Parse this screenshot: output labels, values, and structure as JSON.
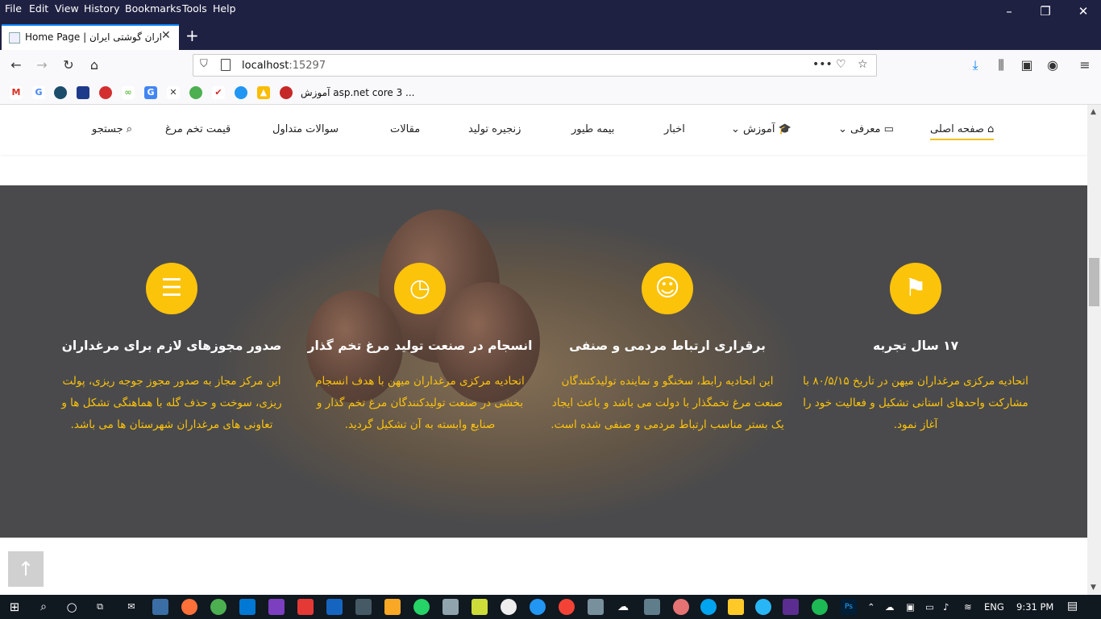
{
  "menubar": {
    "items": [
      "File",
      "Edit",
      "View",
      "History",
      "Bookmarks",
      "Tools",
      "Help"
    ]
  },
  "tab": {
    "title": "Home Page | مرغداران گوشتی ایران",
    "close": "✕",
    "new": "+"
  },
  "url": {
    "host": "localhost",
    "port": ":15297"
  },
  "bookmarks": {
    "text": "آموزش asp.net core 3 ..."
  },
  "sitenav": {
    "home": "صفحه اصلی",
    "intro": "معرفی",
    "education": "آموزش",
    "news": "اخبار",
    "poultry_insurance": "بیمه طیور",
    "supply_chain": "زنجیره تولید",
    "articles": "مقالات",
    "faq": "سوالات متداول",
    "egg_price": "قیمت تخم مرغ",
    "search": "جستجو"
  },
  "features": [
    {
      "title": "۱۷ سال تجربه",
      "desc": "اتحادیه مرکزی مرغداران میهن در تاریخ ۸۰/۵/۱۵ با مشارکت واحدهای استانی تشکیل و فعالیت خود را آغاز نمود.",
      "icon": "flag-icon"
    },
    {
      "title": "برقراری ارتباط مردمی و صنفی",
      "desc": "این اتحادیه رابط، سخنگو و نماینده تولیدکنندگان صنعت مرغ تخمگذار با دولت می باشد و باعث ایجاد یک بستر مناسب ارتباط مردمی و صنفی شده است.",
      "icon": "user-contact-icon"
    },
    {
      "title": "انسجام در صنعت تولید مرغ تخم گذار",
      "desc": "اتحادیه مرکزی مرغداران میهن با هدف انسجام بخشی در صنعت تولیدکنندگان مرغ تخم گذار و صنایع وابسته به آن تشکیل گردید.",
      "icon": "clock-icon"
    },
    {
      "title": "صدور مجوزهای لازم برای مرغداران",
      "desc": "این مرکز مجاز به صدور مجوز جوجه ریزی، پولت ریزی، سوخت و حذف گله با هماهنگی تشکل ها و تعاونی های مرغداران شهرستان ها می باشد.",
      "icon": "sliders-icon"
    }
  ],
  "taskbar": {
    "lang": "ENG",
    "time": "9:31 PM"
  },
  "colors": {
    "accent": "#fcc30b",
    "hero_bg": "#4a4a4c",
    "chrome": "#1f2143"
  }
}
